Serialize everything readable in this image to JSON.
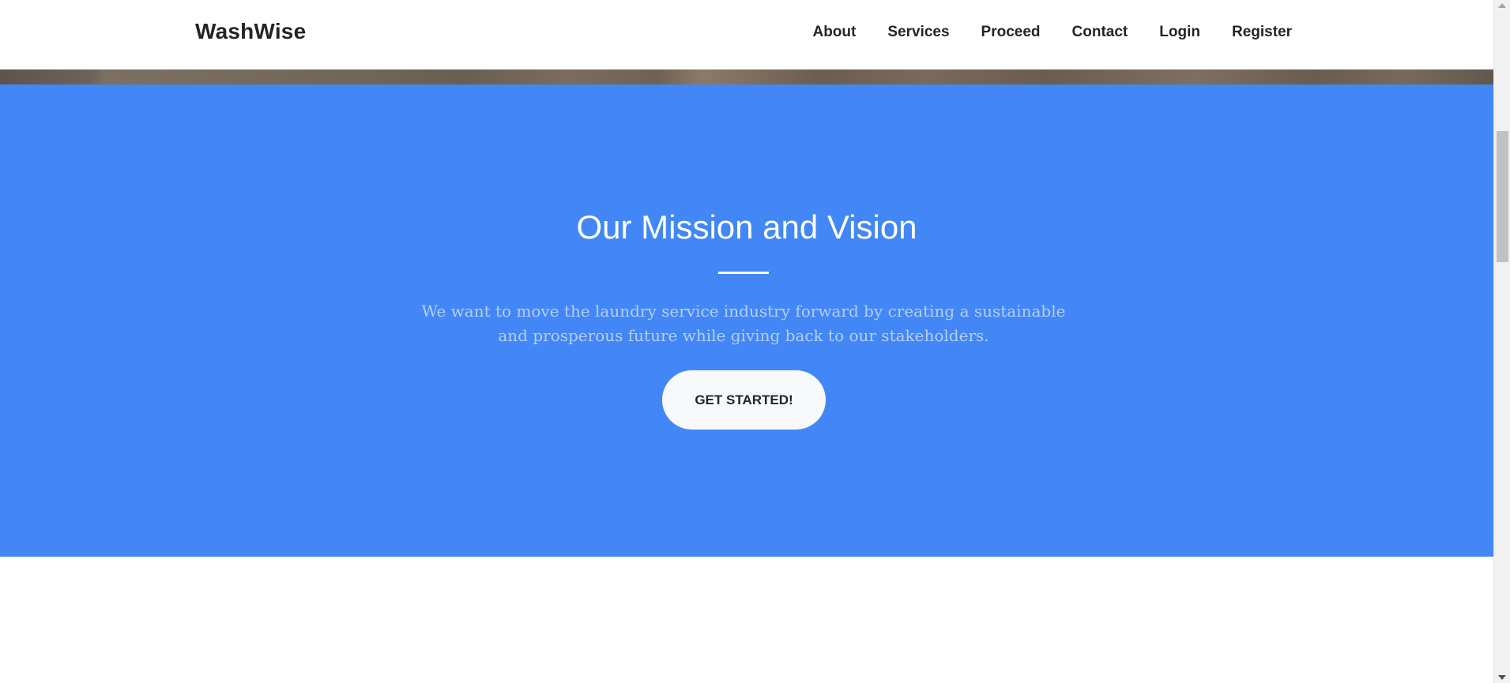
{
  "navbar": {
    "brand": "WashWise",
    "links": [
      "About",
      "Services",
      "Proceed",
      "Contact",
      "Login",
      "Register"
    ]
  },
  "mission": {
    "title": "Our Mission and Vision",
    "text": "We want to move the laundry service industry forward by creating a sustainable and prosperous future while giving back to our stakeholders.",
    "button_label": "GET STARTED!"
  },
  "colors": {
    "accent": "#4287f5",
    "button_bg": "#f8f9fa",
    "text_dark": "#212529"
  },
  "icons": [
    "scroll-up-arrow-icon",
    "scroll-down-arrow-icon"
  ]
}
